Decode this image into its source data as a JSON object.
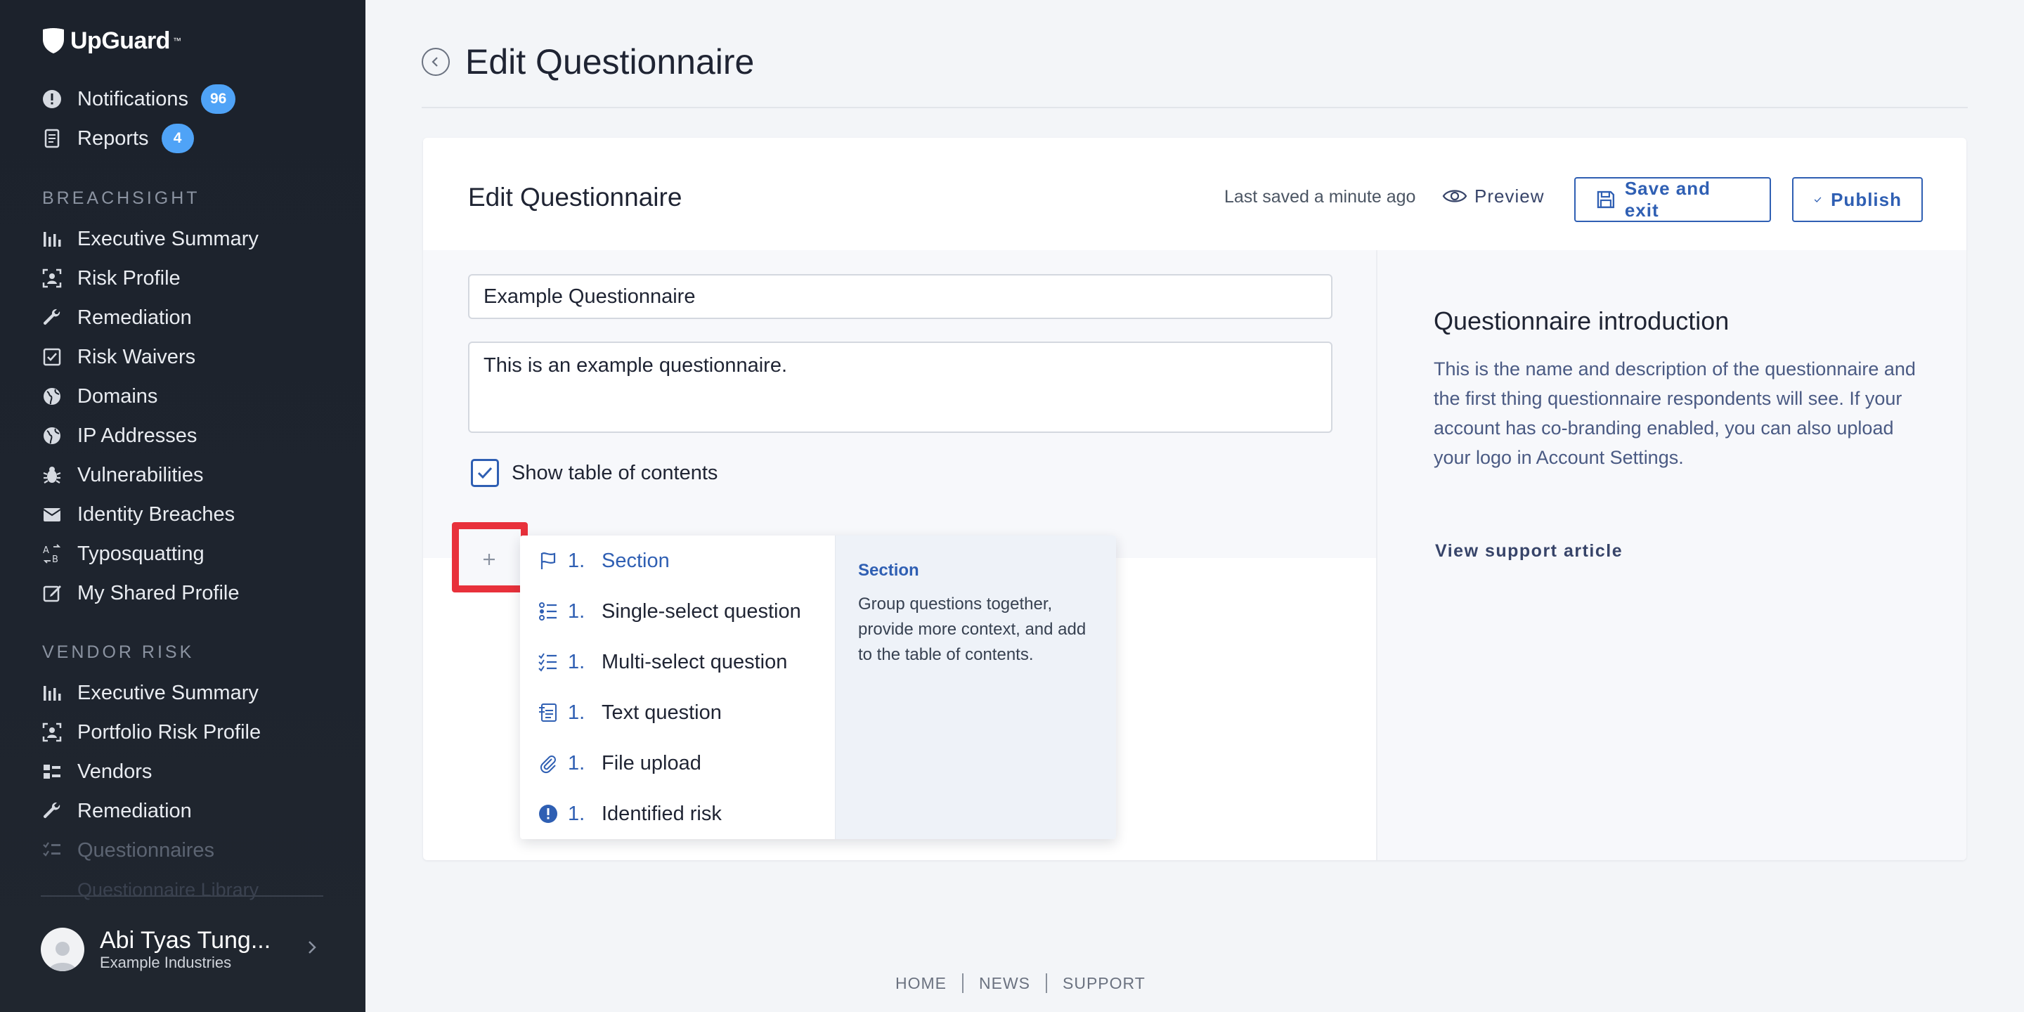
{
  "brand": {
    "name": "UpGuard",
    "mark": "™"
  },
  "sidebar": {
    "top_items": [
      {
        "label": "Notifications",
        "badge": "96",
        "icon": "alert-circle-icon"
      },
      {
        "label": "Reports",
        "badge": "4",
        "icon": "report-icon"
      }
    ],
    "breachsight_heading": "BREACHSIGHT",
    "breachsight": [
      {
        "label": "Executive Summary",
        "icon": "bar-chart-icon"
      },
      {
        "label": "Risk Profile",
        "icon": "risk-profile-icon"
      },
      {
        "label": "Remediation",
        "icon": "wrench-icon"
      },
      {
        "label": "Risk Waivers",
        "icon": "checkbox-icon"
      },
      {
        "label": "Domains",
        "icon": "globe-icon"
      },
      {
        "label": "IP Addresses",
        "icon": "globe-icon"
      },
      {
        "label": "Vulnerabilities",
        "icon": "bug-icon"
      },
      {
        "label": "Identity Breaches",
        "icon": "envelope-icon"
      },
      {
        "label": "Typosquatting",
        "icon": "typosquatting-icon"
      },
      {
        "label": "My Shared Profile",
        "icon": "edit-icon"
      }
    ],
    "vendor_heading": "VENDOR RISK",
    "vendor": [
      {
        "label": "Executive Summary",
        "icon": "bar-chart-icon"
      },
      {
        "label": "Portfolio Risk Profile",
        "icon": "risk-profile-icon"
      },
      {
        "label": "Vendors",
        "icon": "list-icon"
      },
      {
        "label": "Remediation",
        "icon": "wrench-icon"
      },
      {
        "label": "Questionnaires",
        "icon": "checklist-icon"
      },
      {
        "label": "Questionnaire Library",
        "icon": ""
      }
    ],
    "user": {
      "name": "Abi Tyas Tung...",
      "org": "Example Industries"
    }
  },
  "page": {
    "title": "Edit Questionnaire"
  },
  "card": {
    "title": "Edit Questionnaire",
    "last_saved": "Last saved a minute ago",
    "preview_label": "Preview",
    "save_label": "Save and exit",
    "publish_label": "Publish",
    "name_value": "Example Questionnaire",
    "description_value": "This is an example questionnaire.",
    "toc_label": "Show table of contents",
    "toc_checked": true
  },
  "intro": {
    "title": "Questionnaire introduction",
    "text": "This is the name and description of the questionnaire and the first thing questionnaire respondents will see. If your account has co-branding enabled, you can also upload your logo in Account Settings.",
    "link": "View support article"
  },
  "add_menu": {
    "items": [
      {
        "num": "1.",
        "label": "Section",
        "icon": "flag-icon"
      },
      {
        "num": "1.",
        "label": "Single-select question",
        "icon": "single-select-icon"
      },
      {
        "num": "1.",
        "label": "Multi-select question",
        "icon": "multi-select-icon"
      },
      {
        "num": "1.",
        "label": "Text question",
        "icon": "text-question-icon"
      },
      {
        "num": "1.",
        "label": "File upload",
        "icon": "paperclip-icon"
      },
      {
        "num": "1.",
        "label": "Identified risk",
        "icon": "risk-alert-icon"
      }
    ],
    "detail": {
      "title": "Section",
      "text": "Group questions together, provide more context, and add to the table of contents."
    }
  },
  "footer": {
    "home": "HOME",
    "news": "NEWS",
    "support": "SUPPORT"
  },
  "colors": {
    "accent": "#2f5fb3",
    "highlight": "#e8313b",
    "badge": "#4fa3f7"
  }
}
